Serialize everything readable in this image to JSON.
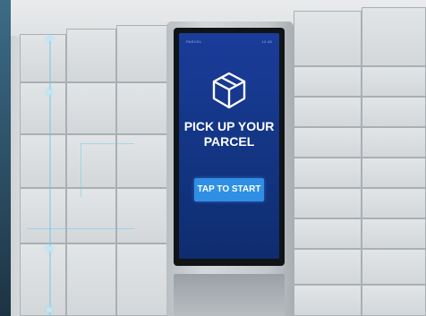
{
  "kiosk": {
    "status_left": "PARCEL",
    "status_right": "12:45",
    "icon": "package-box-icon",
    "headline_line1": "PICK UP YOUR",
    "headline_line2": "PARCEL",
    "cta_label": "TAP TO START"
  },
  "colors": {
    "screen": "#1a3c9a",
    "cta": "#2f8fe4",
    "locker": "#dfe2e4"
  }
}
